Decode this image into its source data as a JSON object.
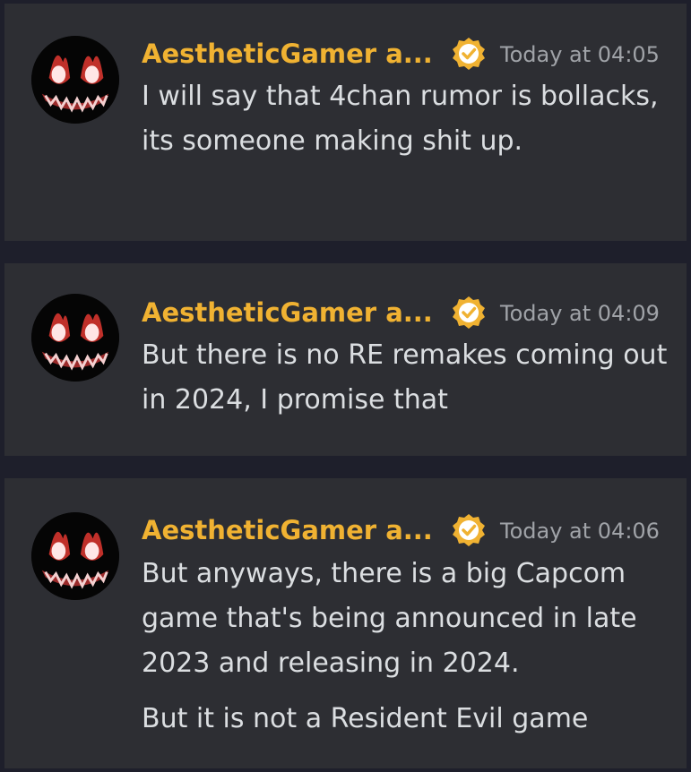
{
  "messages": [
    {
      "author": "AestheticGamer a...",
      "timestamp": "Today at 04:05",
      "lines": [
        "I will say that 4chan rumor is bollacks, its someone making shit up."
      ]
    },
    {
      "author": "AestheticGamer a...",
      "timestamp": "Today at 04:09",
      "lines": [
        "But there is no RE remakes coming out in 2024, I promise that"
      ]
    },
    {
      "author": "AestheticGamer a...",
      "timestamp": "Today at 04:06",
      "lines": [
        "But anyways, there is a big Capcom game that's being announced in late 2023 and releasing in 2024.",
        "But it is not a Resident Evil game"
      ]
    }
  ],
  "icons": {
    "avatar": "demon-face-avatar",
    "badge": "verified-checkmark-badge"
  },
  "colors": {
    "background": "#1e1f2b",
    "card": "#2d2e33",
    "author": "#f0b232",
    "timestamp": "#a0a3a8",
    "text": "#dbdee1",
    "badge": "#f0b232"
  }
}
